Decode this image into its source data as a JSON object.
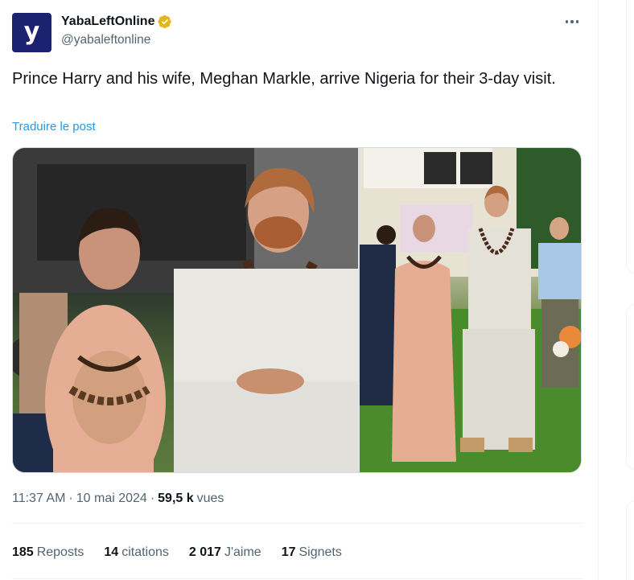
{
  "author": {
    "display_name": "YabaLeftOnline",
    "handle": "@yabaleftonline",
    "avatar_glyph": "y",
    "verified": true,
    "verified_color": "#e2b719"
  },
  "tweet": {
    "text": "Prince Harry and his wife, Meghan Markle, arrive Nigeria for their 3-day visit.",
    "translate_label": "Traduire le post"
  },
  "meta": {
    "time": "11:37 AM",
    "date": "10 mai 2024",
    "separator": "·",
    "views_count": "59,5 k",
    "views_label": "vues"
  },
  "engagement": [
    {
      "count": "185",
      "label": "Reposts"
    },
    {
      "count": "14",
      "label": "citations"
    },
    {
      "count": "2 017",
      "label": "J'aime"
    },
    {
      "count": "17",
      "label": "Signets"
    }
  ],
  "colors": {
    "accent": "#1d9bf0",
    "text_primary": "#0f1419",
    "text_secondary": "#536471",
    "avatar_bg": "#1c2170"
  },
  "icons": {
    "more": "more-horizontal-icon",
    "verified": "verified-badge-icon"
  }
}
